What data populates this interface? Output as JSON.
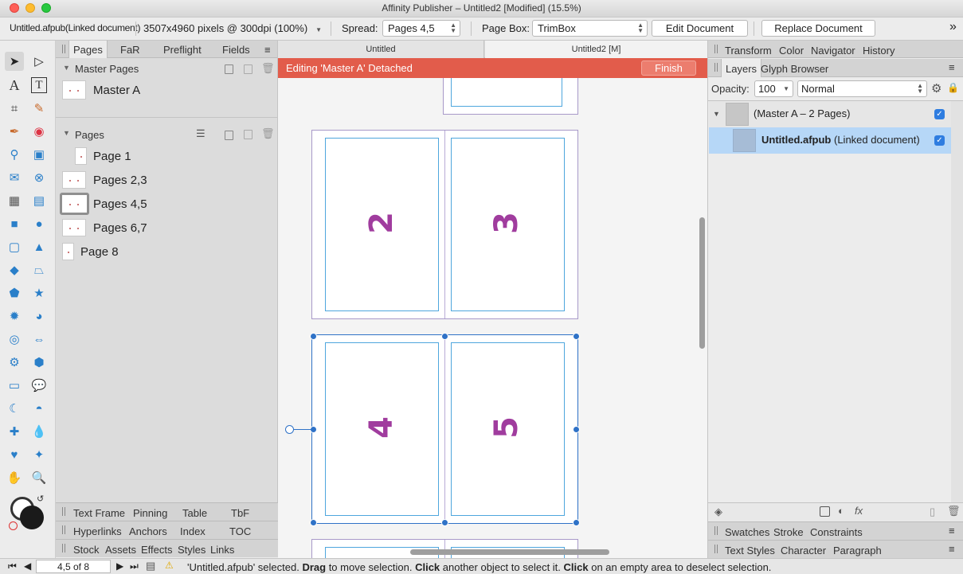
{
  "window": {
    "title": "Affinity Publisher – Untitled2 [Modified] (15.5%)"
  },
  "context_toolbar": {
    "selection_name": "Untitled.afpub(Linked document)",
    "doc_info": "3507x4960 pixels @ 300dpi (100%)",
    "spread_label": "Spread:",
    "spread_value": "Pages 4,5",
    "pagebox_label": "Page Box:",
    "pagebox_value": "TrimBox",
    "edit_document": "Edit Document",
    "replace_document": "Replace Document",
    "more": "»"
  },
  "left_panel": {
    "tabs": [
      "Pages",
      "FaR",
      "Preflight",
      "Fields"
    ],
    "master_pages_header": "Master Pages",
    "master_pages": [
      {
        "label": "Master A"
      }
    ],
    "pages_header": "Pages",
    "pages": [
      {
        "label": "Page 1"
      },
      {
        "label": "Pages 2,3"
      },
      {
        "label": "Pages 4,5"
      },
      {
        "label": "Pages 6,7"
      },
      {
        "label": "Page 8"
      }
    ],
    "bottom_tabs_1": [
      "Text Frame",
      "Pinning",
      "Table",
      "TbF"
    ],
    "bottom_tabs_2": [
      "Hyperlinks",
      "Anchors",
      "Index",
      "TOC"
    ],
    "bottom_tabs_3": [
      "Stock",
      "Assets",
      "Effects",
      "Styles",
      "Links"
    ]
  },
  "document_tabs": [
    "Untitled",
    "Untitled2 [M]"
  ],
  "banner": {
    "text": "Editing 'Master A' Detached",
    "finish": "Finish"
  },
  "canvas": {
    "page_numbers": [
      "2",
      "3",
      "4",
      "5"
    ]
  },
  "right_panel": {
    "top_tabs": [
      "Transform",
      "Color",
      "Navigator",
      "History"
    ],
    "layer_tabs": [
      "Layers",
      "Glyph Browser"
    ],
    "opacity_label": "Opacity:",
    "opacity_value": "100",
    "blend_mode": "Normal",
    "layers": [
      {
        "name": "(Master A – 2 Pages)",
        "suffix": ""
      },
      {
        "name": "Untitled.afpub",
        "suffix": " (Linked document)"
      }
    ],
    "bottom_tabs_1": [
      "Swatches",
      "Stroke",
      "Constraints"
    ],
    "bottom_tabs_2": [
      "Text Styles",
      "Character",
      "Paragraph"
    ]
  },
  "status_bar": {
    "page_indicator": "4,5 of 8",
    "message_prefix": "'Untitled.afpub' selected. ",
    "drag": "Drag",
    "msg1": " to move selection. ",
    "click1": "Click",
    "msg2": " another object to select it. ",
    "click2": "Click",
    "msg3": " on an empty area to deselect selection."
  },
  "colors": {
    "banner": "#e25c4b",
    "accent": "#2f72c7",
    "page_number": "#a03c9e"
  }
}
